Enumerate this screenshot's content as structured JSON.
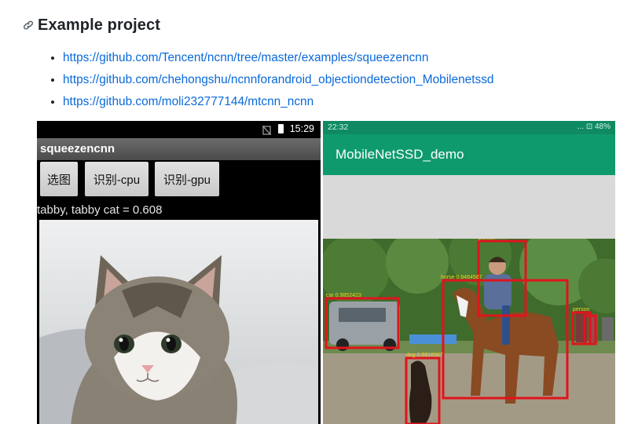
{
  "heading": {
    "title": "Example project",
    "icon": "link-icon"
  },
  "links": [
    "https://github.com/Tencent/ncnn/tree/master/examples/squeezencnn",
    "https://github.com/chehongshu/ncnnforandroid_objectiondetection_Mobilenetssd",
    "https://github.com/moli232777144/mtcnn_ncnn"
  ],
  "phone_left": {
    "status_time": "15:29",
    "app_title": "squeezencnn",
    "buttons": [
      "选图",
      "识别-cpu",
      "识别-gpu"
    ],
    "result": "tabby, tabby cat = 0.608"
  },
  "phone_right": {
    "status_time": "22:32",
    "status_right": "... ⊡ 48%",
    "app_title": "MobileNetSSD_demo",
    "detections": [
      "car 0.9852423",
      "horse 0.9464567",
      "dog 0.9816567",
      "person",
      "person"
    ]
  },
  "colors": {
    "link": "#0969da",
    "app_bar": "#0f9a6e",
    "detection_box": "#e0141c"
  }
}
